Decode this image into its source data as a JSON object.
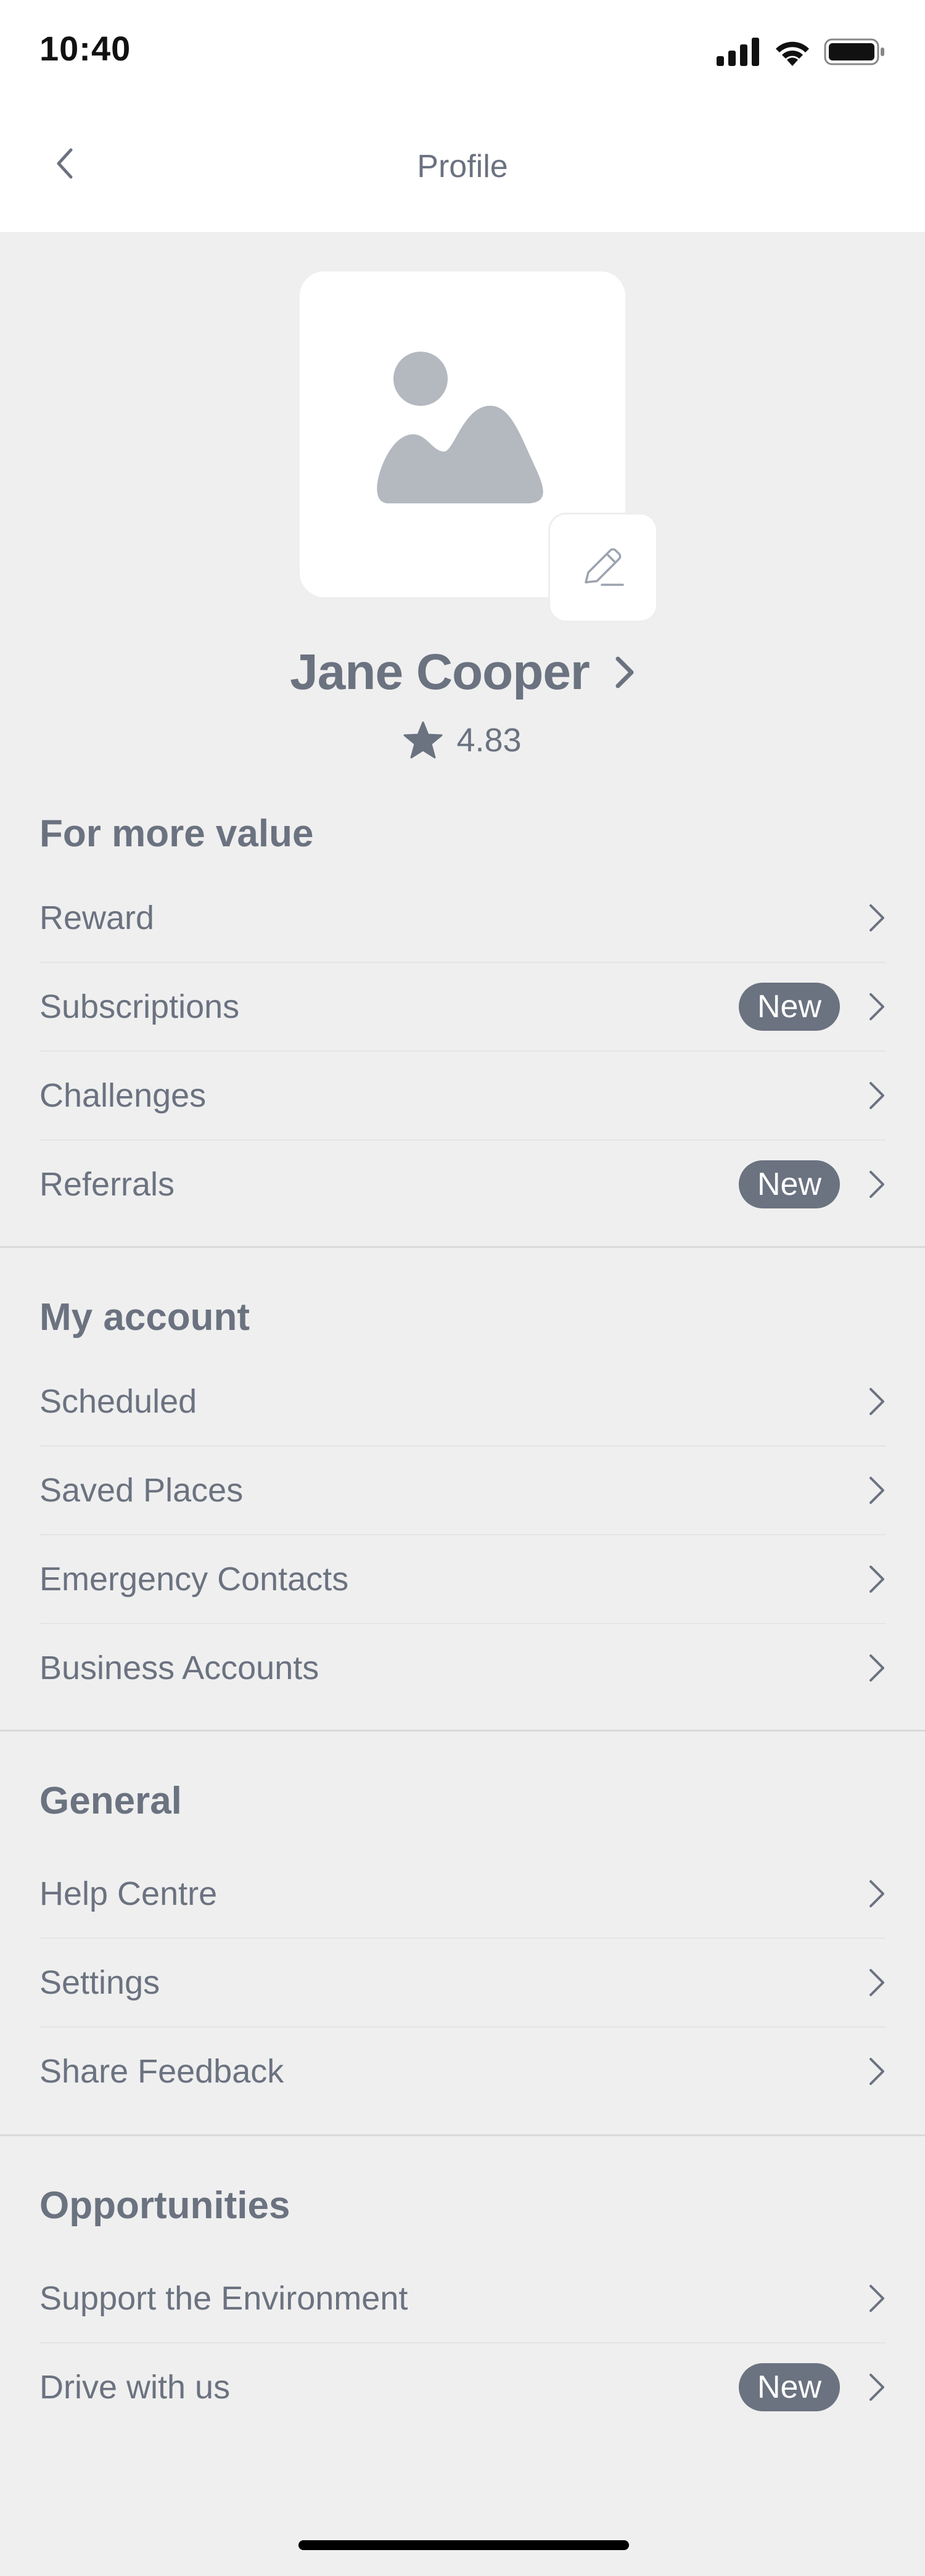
{
  "status_bar": {
    "time": "10:40"
  },
  "nav": {
    "title": "Profile"
  },
  "profile": {
    "name": "Jane Cooper",
    "rating": "4.83"
  },
  "sections": {
    "value": {
      "title": "For more value",
      "items": [
        {
          "label": "Reward"
        },
        {
          "label": "Subscriptions",
          "badge": "New"
        },
        {
          "label": "Challenges"
        },
        {
          "label": "Referrals",
          "badge": "New"
        }
      ]
    },
    "account": {
      "title": "My account",
      "items": [
        {
          "label": "Scheduled"
        },
        {
          "label": "Saved Places"
        },
        {
          "label": "Emergency Contacts"
        },
        {
          "label": "Business Accounts"
        }
      ]
    },
    "general": {
      "title": "General",
      "items": [
        {
          "label": "Help Centre"
        },
        {
          "label": "Settings"
        },
        {
          "label": "Share Feedback"
        }
      ]
    },
    "opportunities": {
      "title": "Opportunities",
      "items": [
        {
          "label": "Support the Environment"
        },
        {
          "label": "Drive with us",
          "badge": "New"
        }
      ]
    }
  },
  "colors": {
    "background": "#efefef",
    "text": "#6b7280",
    "badge": "#6b7280",
    "surface": "#ffffff"
  }
}
